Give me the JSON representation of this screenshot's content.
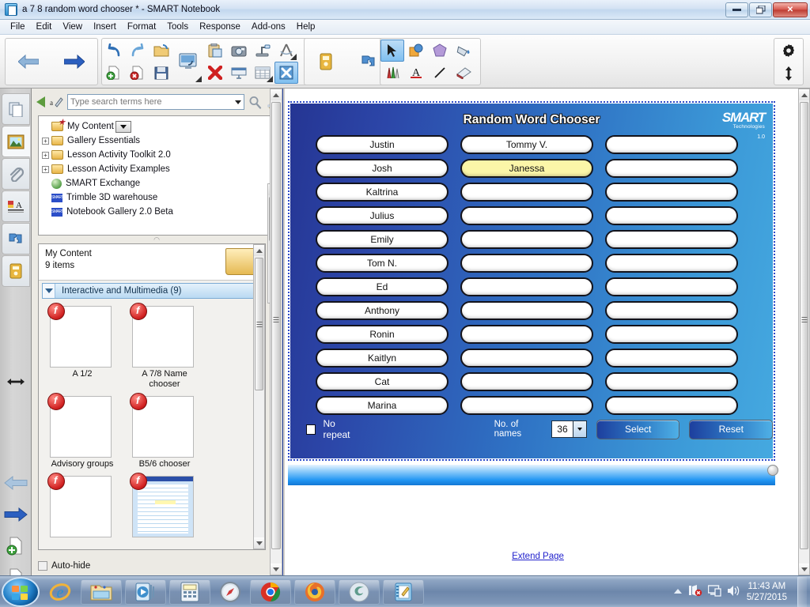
{
  "window": {
    "title": "a 7 8 random word chooser * - SMART Notebook",
    "app_icon": "notebook-icon",
    "minimize_label": "—",
    "restore_label": "❐",
    "close_label": "✕"
  },
  "menubar": {
    "items": [
      "File",
      "Edit",
      "View",
      "Insert",
      "Format",
      "Tools",
      "Response",
      "Add-ons",
      "Help"
    ]
  },
  "toolbar": {
    "groups": [
      {
        "name": "navigation",
        "buttons": [
          {
            "name": "previous-page-button",
            "icon": "arrow-left-icon"
          },
          {
            "name": "next-page-button",
            "icon": "arrow-right-icon"
          }
        ]
      },
      {
        "name": "file-edit",
        "buttons": [
          {
            "name": "undo-button",
            "icon": "undo-icon"
          },
          {
            "name": "redo-button",
            "icon": "redo-icon"
          },
          {
            "name": "open-button",
            "icon": "open-folder-icon"
          },
          {
            "name": "add-page-button",
            "icon": "page-add-icon"
          },
          {
            "name": "delete-page-button",
            "icon": "page-delete-icon"
          },
          {
            "name": "save-button",
            "icon": "save-disk-icon"
          },
          {
            "name": "screen-shade-button",
            "icon": "screen-shade-icon"
          },
          {
            "name": "paste-button",
            "icon": "paste-icon"
          },
          {
            "name": "delete-button",
            "icon": "red-x-icon"
          },
          {
            "name": "screen-capture-button",
            "icon": "camera-icon"
          },
          {
            "name": "full-screen-button",
            "icon": "projector-icon"
          },
          {
            "name": "document-camera-button",
            "icon": "doc-camera-icon"
          },
          {
            "name": "table-button",
            "icon": "table-icon"
          },
          {
            "name": "measurement-tools-button",
            "icon": "compass-icon"
          },
          {
            "name": "transparency-button",
            "icon": "transparency-icon"
          }
        ]
      },
      {
        "name": "response",
        "buttons": [
          {
            "name": "smart-response-button",
            "icon": "response-clicker-icon"
          },
          {
            "name": "add-ons-button",
            "icon": "puzzle-piece-icon"
          }
        ]
      },
      {
        "name": "tools",
        "buttons": [
          {
            "name": "select-tool",
            "icon": "cursor-arrow-icon",
            "selected": true
          },
          {
            "name": "creative-pen-tool",
            "icon": "shapes-icon"
          },
          {
            "name": "shapes-tool",
            "icon": "polygon-icon"
          },
          {
            "name": "fill-tool",
            "icon": "paint-bucket-icon"
          },
          {
            "name": "pens-tool",
            "icon": "pens-icon"
          },
          {
            "name": "text-tool",
            "icon": "text-a-icon"
          },
          {
            "name": "line-tool",
            "icon": "line-icon"
          },
          {
            "name": "eraser-tool",
            "icon": "eraser-icon"
          }
        ]
      },
      {
        "name": "customize",
        "buttons": [
          {
            "name": "customize-toolbar-button",
            "icon": "gear-icon"
          },
          {
            "name": "move-toolbar-button",
            "icon": "updown-arrows-icon"
          }
        ]
      }
    ]
  },
  "rail": {
    "buttons": [
      {
        "name": "page-sorter-tab",
        "icon": "pages-icon"
      },
      {
        "name": "gallery-tab",
        "icon": "picture-frame-icon",
        "active": true
      },
      {
        "name": "attachments-tab",
        "icon": "paperclip-icon"
      },
      {
        "name": "properties-tab",
        "icon": "properties-icon"
      },
      {
        "name": "add-ons-tab",
        "icon": "puzzle-piece-icon"
      },
      {
        "name": "smart-response-tab",
        "icon": "response-clicker-icon"
      }
    ],
    "lower": [
      {
        "name": "move-panel-handle",
        "icon": "horizontal-resize-icon"
      },
      {
        "name": "previous-page-rail",
        "icon": "arrow-left-icon"
      },
      {
        "name": "next-page-rail",
        "icon": "arrow-right-icon"
      },
      {
        "name": "add-page-rail",
        "icon": "page-add-icon"
      },
      {
        "name": "delete-page-rail",
        "icon": "page-delete-icon"
      }
    ]
  },
  "gallery": {
    "search": {
      "placeholder": "Type search terms here",
      "value": ""
    },
    "back_icon": "back-arrow-icon",
    "pencil_icon": "edit-pencil-icon",
    "search_icon": "magnifier-icon",
    "clear_icon": "clear-search-icon",
    "tree": [
      {
        "label": "My Content",
        "icon": "folder-star-icon",
        "expandable": false,
        "dropdown": true
      },
      {
        "label": "Gallery Essentials",
        "icon": "folder-icon",
        "expandable": true
      },
      {
        "label": "Lesson Activity Toolkit 2.0",
        "icon": "folder-icon",
        "expandable": true
      },
      {
        "label": "Lesson Activity Examples",
        "icon": "folder-icon",
        "expandable": true
      },
      {
        "label": "SMART Exchange",
        "icon": "globe-icon",
        "expandable": false
      },
      {
        "label": "Trimble 3D warehouse",
        "icon": "smart-square-icon",
        "expandable": false
      },
      {
        "label": "Notebook Gallery 2.0 Beta",
        "icon": "smart-square-icon",
        "expandable": false
      }
    ],
    "content": {
      "title": "My Content",
      "count_label": "9 items",
      "folder_icon": "folder-star-icon",
      "group_header": "Interactive and Multimedia (9)",
      "thumbnails": [
        {
          "label": "A 1/2",
          "icon": "flash-file-icon"
        },
        {
          "label": "A 7/8 Name chooser",
          "icon": "flash-file-icon"
        },
        {
          "label": "Advisory groups",
          "icon": "flash-file-icon"
        },
        {
          "label": "B5/6 chooser",
          "icon": "flash-file-icon"
        },
        {
          "label": "",
          "icon": "flash-file-icon"
        },
        {
          "label": "",
          "icon": "flash-file-icon"
        }
      ]
    },
    "autohide_label": "Auto-hide"
  },
  "chooser": {
    "title": "Random Word Chooser",
    "brand": "SMART",
    "brand_sub": "Technologies",
    "version": "1.0",
    "columns": [
      [
        "Justin",
        "Josh",
        "Kaltrina",
        "Julius",
        "Emily",
        "Tom N.",
        "Ed",
        "Anthony",
        "Ronin",
        "Kaitlyn",
        "Cat",
        "Marina"
      ],
      [
        "Tommy V.",
        "Janessa",
        "",
        "",
        "",
        "",
        "",
        "",
        "",
        "",
        "",
        ""
      ],
      [
        "",
        "",
        "",
        "",
        "",
        "",
        "",
        "",
        "",
        "",
        "",
        ""
      ]
    ],
    "highlighted": {
      "column": 1,
      "row": 1,
      "color": "#fbf6a8"
    },
    "no_repeat_label": "No repeat",
    "no_repeat_checked": false,
    "num_names_label": "No. of names",
    "num_names_value": "36",
    "select_button": "Select",
    "reset_button": "Reset",
    "accent_dark": "#253593",
    "accent_light": "#45a9e0"
  },
  "canvas": {
    "extend_page_label": "Extend Page"
  },
  "taskbar": {
    "start_icon": "windows-start-icon",
    "items": [
      {
        "name": "internet-explorer",
        "icon": "ie-icon"
      },
      {
        "name": "windows-explorer",
        "icon": "explorer-folder-icon"
      },
      {
        "name": "media-player",
        "icon": "media-player-icon"
      },
      {
        "name": "calculator",
        "icon": "calculator-icon"
      },
      {
        "name": "safari",
        "icon": "safari-compass-icon"
      },
      {
        "name": "google-chrome",
        "icon": "chrome-icon"
      },
      {
        "name": "mozilla-firefox",
        "icon": "firefox-icon"
      },
      {
        "name": "smart-app",
        "icon": "smart-swirl-icon"
      },
      {
        "name": "smart-notebook",
        "icon": "notebook-icon"
      }
    ],
    "tray": {
      "expand_icon": "show-hidden-icons-icon",
      "network_icon": "network-error-icon",
      "monitor_icon": "monitor-icon",
      "volume_icon": "speaker-icon",
      "time": "11:43 AM",
      "date": "5/27/2015"
    }
  }
}
